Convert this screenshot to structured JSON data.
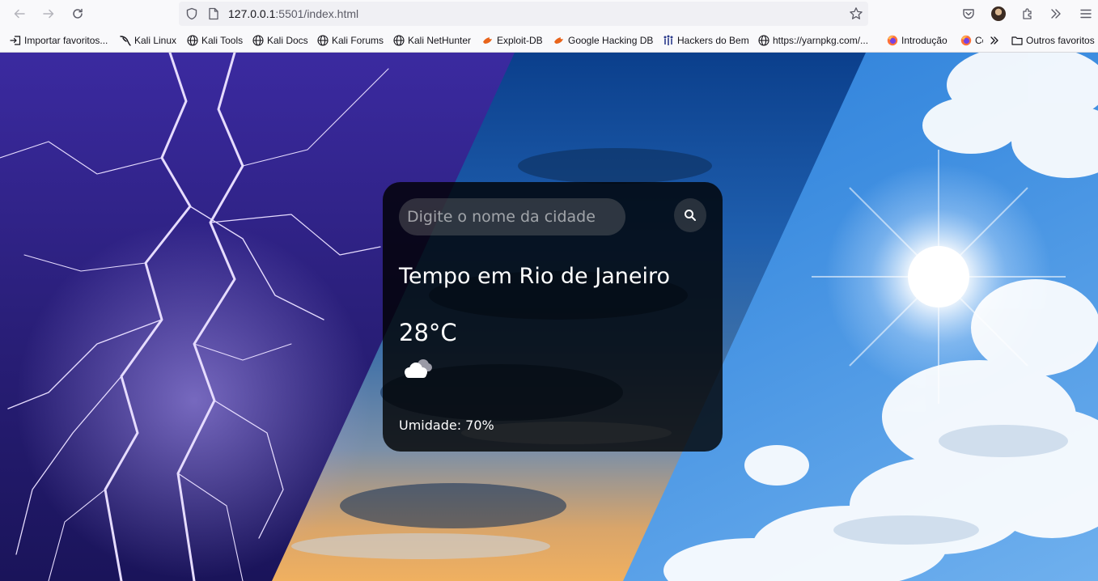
{
  "browser": {
    "url_host": "127.0.0.1",
    "url_rest": ":5501/index.html",
    "bookmarks": [
      {
        "label": "Importar favoritos...",
        "icon": "import-icon"
      },
      {
        "label": "Kali Linux",
        "icon": "kali-dragon-icon"
      },
      {
        "label": "Kali Tools",
        "icon": "globe-icon"
      },
      {
        "label": "Kali Docs",
        "icon": "globe-icon"
      },
      {
        "label": "Kali Forums",
        "icon": "globe-icon"
      },
      {
        "label": "Kali NetHunter",
        "icon": "globe-icon"
      },
      {
        "label": "Exploit-DB",
        "icon": "exploit-db-icon"
      },
      {
        "label": "Google Hacking DB",
        "icon": "exploit-db-icon"
      },
      {
        "label": "Hackers do Bem",
        "icon": "hackers-do-bem-icon"
      },
      {
        "label": "https://yarnpkg.com/...",
        "icon": "globe-icon"
      },
      {
        "label": "Introdução",
        "icon": "firefox-icon"
      },
      {
        "label": "Co",
        "icon": "firefox-icon"
      }
    ],
    "other_bookmarks": "Outros favoritos"
  },
  "weather_card": {
    "search_placeholder": "Digite o nome da cidade",
    "city_title": "Tempo em Rio de Janeiro",
    "temperature": "28°C",
    "weather_icon": "cloudy-icon",
    "humidity": "Umidade: 70%"
  },
  "colors": {
    "card_background": "rgba(0,0,0,0.80)",
    "card_text": "#ffffff",
    "storm_purple": "#2e2184",
    "sky_blue": "#2f7fd2"
  }
}
